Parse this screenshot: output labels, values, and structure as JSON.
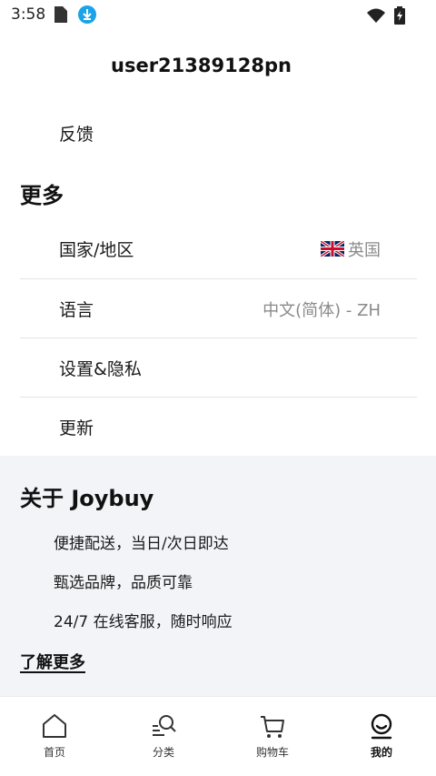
{
  "status_bar": {
    "time": "3:58"
  },
  "profile": {
    "username": "user21389128pn"
  },
  "feedback": {
    "label": "反馈"
  },
  "more": {
    "title": "更多",
    "items": [
      {
        "label": "国家/地区",
        "value": "英国",
        "icon": "uk-flag-icon"
      },
      {
        "label": "语言",
        "value": "中文(简体) - ZH"
      },
      {
        "label": "设置&隐私"
      },
      {
        "label": "更新"
      }
    ]
  },
  "about": {
    "title": "关于 Joybuy",
    "lines": [
      "便捷配送，当日/次日即达",
      "甄选品牌，品质可靠",
      "24/7 在线客服，随时响应"
    ],
    "learn_more": "了解更多"
  },
  "tabbar": {
    "tabs": [
      {
        "label": "首页",
        "icon": "home-icon"
      },
      {
        "label": "分类",
        "icon": "category-search-icon"
      },
      {
        "label": "购物车",
        "icon": "cart-icon"
      },
      {
        "label": "我的",
        "icon": "profile-icon",
        "active": true
      }
    ]
  },
  "colors": {
    "about_bg": "#f2f4f8",
    "download_badge": "#1aa3e8",
    "secondary_text": "#8a8a8a",
    "divider": "#e3e3e3"
  }
}
